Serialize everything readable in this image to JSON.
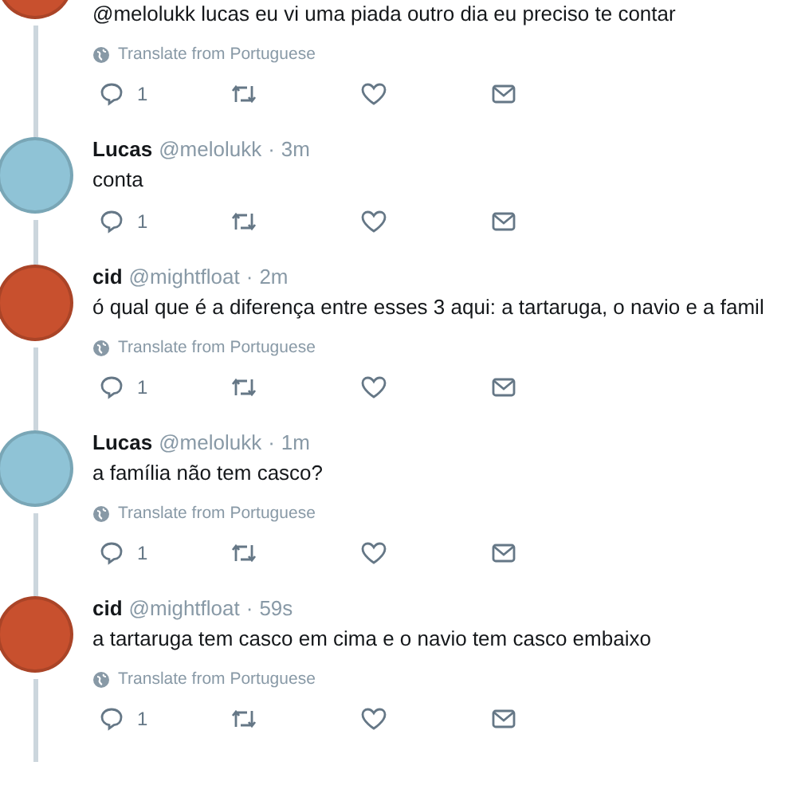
{
  "tweets": [
    {
      "kind": "partial",
      "avatar": {
        "color": "#c8502e"
      },
      "text": "@melolukk lucas eu vi uma piada outro dia eu preciso te contar",
      "translate": "Translate from Portuguese",
      "replies": "1"
    },
    {
      "kind": "full",
      "avatar": {
        "color": "#8fc3d6"
      },
      "name": "Lucas",
      "handle": "@melolukk",
      "separator": "·",
      "time": "3m",
      "text": "conta",
      "replies": "1"
    },
    {
      "kind": "full",
      "avatar": {
        "color": "#c8502e"
      },
      "name": "cid",
      "handle": "@mightfloat",
      "separator": "·",
      "time": "2m",
      "text": "ó qual que é a diferença entre esses 3 aqui: a tartaruga, o navio e a famil",
      "translate": "Translate from Portuguese",
      "replies": "1"
    },
    {
      "kind": "full",
      "avatar": {
        "color": "#8fc3d6"
      },
      "name": "Lucas",
      "handle": "@melolukk",
      "separator": "·",
      "time": "1m",
      "text": "a família não tem casco?",
      "translate": "Translate from Portuguese",
      "replies": "1"
    },
    {
      "kind": "full",
      "avatar": {
        "color": "#c8502e"
      },
      "name": "cid",
      "handle": "@mightfloat",
      "separator": "·",
      "time": "59s",
      "text": "a tartaruga tem casco em cima e o navio tem casco embaixo",
      "translate": "Translate from Portuguese",
      "replies": "1"
    }
  ]
}
